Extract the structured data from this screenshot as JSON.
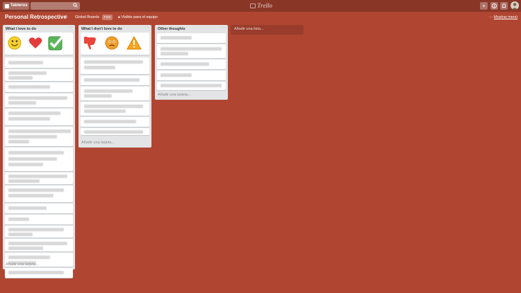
{
  "header": {
    "boards_label": "Tableros",
    "search_icon": "🔍",
    "logo": "Trello",
    "buttons": [
      {
        "name": "add-button",
        "icon": "+"
      },
      {
        "name": "info-button",
        "icon": "ⓘ"
      },
      {
        "name": "notifications-button",
        "icon": "🔔"
      }
    ]
  },
  "board": {
    "title": "Personal Retrospective",
    "star": "☆",
    "org": "Global Boards",
    "org_badge": "Free",
    "visibility": "Visible para el equipo",
    "menu_prefix": "···",
    "menu_label": "Mostrar menú"
  },
  "lists": [
    {
      "title": "What I love to do",
      "menu": "···",
      "icons": [
        "smiley-face",
        "red-heart",
        "green-checkmark"
      ],
      "add_card": "Añadir una tarjeta..."
    },
    {
      "title": "What I don't love to do",
      "menu": "···",
      "icons": [
        "thumbs-down",
        "frowning-face",
        "warning-sign"
      ],
      "add_card": "Añadir una tarjeta..."
    },
    {
      "title": "Other thoughts",
      "menu": "···",
      "add_card": "Añadir una tarjeta..."
    }
  ],
  "add_list": "Añadir una lista...",
  "colors": {
    "background": "#b04632",
    "header": "#8a3627",
    "list": "#e2e4e6"
  }
}
